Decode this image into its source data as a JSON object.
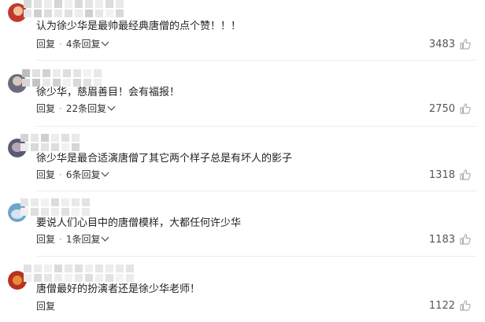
{
  "comments": [
    {
      "text": "认为徐少华是最帅最经典唐僧的点个赞！！！",
      "reply_label": "回复",
      "replies_label": "4条回复",
      "likes": "3483",
      "avatar_colors": [
        "#c0392b",
        "#f2c09e"
      ]
    },
    {
      "text": "徐少华，慈眉善目！会有福报！",
      "reply_label": "回复",
      "replies_label": "22条回复",
      "likes": "2750",
      "avatar_colors": [
        "#6b6b7e",
        "#d9c7b8"
      ]
    },
    {
      "text": "徐少华是最合适演唐僧了其它两个样子总是有坏人的影子",
      "reply_label": "回复",
      "replies_label": "6条回复",
      "likes": "1318",
      "avatar_colors": [
        "#5a5a73",
        "#b7a6b4"
      ]
    },
    {
      "text": "要说人们心目中的唐僧模样，大都任何许少华",
      "reply_label": "回复",
      "replies_label": "1条回复",
      "likes": "1183",
      "avatar_colors": [
        "#6ea6c9",
        "#d4e5ef"
      ]
    },
    {
      "text": "唐僧最好的扮演者还是徐少华老师！",
      "reply_label": "回复",
      "replies_label": "",
      "likes": "1122",
      "avatar_colors": [
        "#b8321f",
        "#e88b3a"
      ]
    }
  ],
  "icons": {
    "like": "thumbs-up-icon",
    "expand": "chevron-down-icon"
  },
  "colors": {
    "text": "#222222",
    "meta": "#333333",
    "divider": "#ececec",
    "icon": "#b0b0b0"
  }
}
